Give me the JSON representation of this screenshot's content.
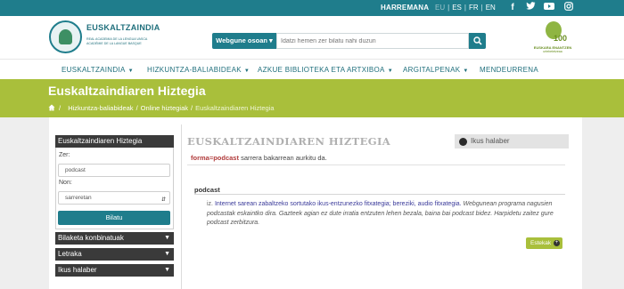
{
  "topbar": {
    "contact": "HARREMANA",
    "languages": [
      "EU",
      "ES",
      "FR",
      "EN"
    ],
    "social_icons": [
      "facebook-icon",
      "twitter-icon",
      "youtube-icon",
      "instagram-icon"
    ]
  },
  "header": {
    "logo_title": "EUSKALTZAINDIA",
    "logo_sub1": "REAL ACADEMIA DE LA LENGUA VASCA",
    "logo_sub2": "ACADÉMIE DE LA LANGUE BASQUE",
    "search_scope": "Webgune osoan ▾",
    "search_placeholder": "Idatzi hemen zer bilatu nahi duzun",
    "badge_number": "100",
    "badge_line1": "EUSKARA ENANTZEN",
    "badge_line2": "urtebetetzeaa"
  },
  "nav": {
    "items": [
      "EUSKALTZAINDIA",
      "HIZKUNTZA-BALIABIDEAK",
      "AZKUE BIBLIOTEKA ETA ARTXIBOA",
      "ARGITALPENAK",
      "MENDEURRENA"
    ]
  },
  "band": {
    "title": "Euskaltzaindiaren Hiztegia",
    "breadcrumb": [
      "Hizkuntza-baliabideak",
      "Online hiztegiak",
      "Euskaltzaindiaren Hiztegia"
    ]
  },
  "sidebar": {
    "heading": "Euskaltzaindiaren Hiztegia",
    "label_zer": "Zer:",
    "query_value": "podcast",
    "label_non": "Non:",
    "where_value": "sarreretan",
    "submit": "Bilatu",
    "accordions": [
      "Bilaketa konbinatuak",
      "Letraka",
      "Ikus halaber"
    ]
  },
  "content": {
    "title": "EUSKALTZAINDIAREN HIZTEGIA",
    "ikus_halaber": "Ikus halaber",
    "result_highlight": "forma=podcast",
    "result_text": " sarrera bakarrean aurkitu da.",
    "entry_head": "podcast",
    "pos": "iz.",
    "definition": " Internet sarean zabaltzeko sortutako ikus-entzunezko fitxategia; bereziki, audio fitxategia.",
    "example": " Webgunean programa nagusien podcastak eskaintko dira. Gazteek agian ez dute irratia entzuten lehen bezala, baina bai podcast bidez. Harpidetu zaitez gure podcast zerbitzura.",
    "links_button": "Estekak"
  }
}
